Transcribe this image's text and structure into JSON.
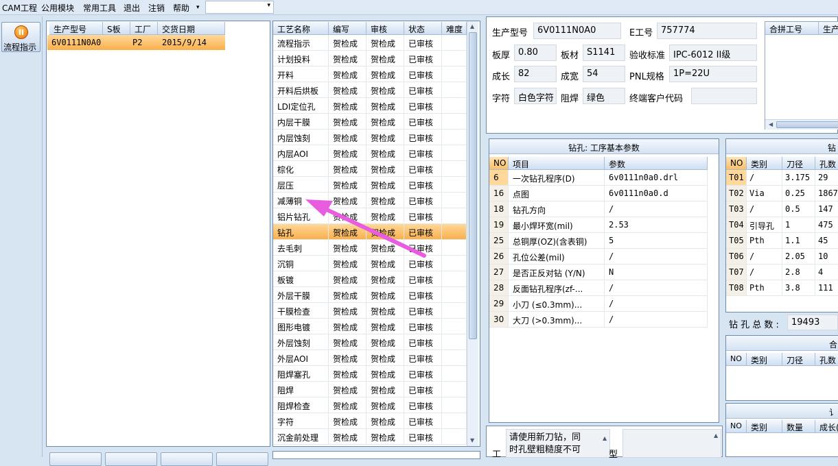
{
  "menu": {
    "items": [
      "CAM工程",
      "公用模块",
      "常用工具",
      "退出",
      "注销",
      "帮助"
    ],
    "help_arrow": "▾",
    "combo_arrow": "▾",
    "combo_value": ""
  },
  "nav": {
    "flow_label": "流程指示"
  },
  "orders": {
    "headers": [
      "生产型号",
      "S板",
      "工厂",
      "交货日期"
    ],
    "rows": [
      [
        "6V0111N0A0",
        "",
        "P2",
        "2015/9/14"
      ]
    ]
  },
  "process": {
    "headers": [
      "工艺名称",
      "编写",
      "审核",
      "状态",
      "难度"
    ],
    "selected_index": 12,
    "rows": [
      [
        "流程指示",
        "贺检成",
        "贺检成",
        "已审核",
        ""
      ],
      [
        "计划投料",
        "贺检成",
        "贺检成",
        "已审核",
        ""
      ],
      [
        "开料",
        "贺检成",
        "贺检成",
        "已审核",
        ""
      ],
      [
        "开料后烘板",
        "贺检成",
        "贺检成",
        "已审核",
        ""
      ],
      [
        "LDI定位孔",
        "贺检成",
        "贺检成",
        "已审核",
        ""
      ],
      [
        "内层干膜",
        "贺检成",
        "贺检成",
        "已审核",
        ""
      ],
      [
        "内层蚀刻",
        "贺检成",
        "贺检成",
        "已审核",
        ""
      ],
      [
        "内层AOI",
        "贺检成",
        "贺检成",
        "已审核",
        ""
      ],
      [
        "棕化",
        "贺检成",
        "贺检成",
        "已审核",
        ""
      ],
      [
        "层压",
        "贺检成",
        "贺检成",
        "已审核",
        ""
      ],
      [
        "减薄铜",
        "贺检成",
        "贺检成",
        "已审核",
        ""
      ],
      [
        "铝片钻孔",
        "贺检成",
        "贺检成",
        "已审核",
        ""
      ],
      [
        "钻孔",
        "贺检成",
        "贺检成",
        "已审核",
        ""
      ],
      [
        "去毛刺",
        "贺检成",
        "贺检成",
        "已审核",
        ""
      ],
      [
        "沉铜",
        "贺检成",
        "贺检成",
        "已审核",
        ""
      ],
      [
        "板镀",
        "贺检成",
        "贺检成",
        "已审核",
        ""
      ],
      [
        "外层干膜",
        "贺检成",
        "贺检成",
        "已审核",
        ""
      ],
      [
        "干膜检查",
        "贺检成",
        "贺检成",
        "已审核",
        ""
      ],
      [
        "图形电镀",
        "贺检成",
        "贺检成",
        "已审核",
        ""
      ],
      [
        "外层蚀刻",
        "贺检成",
        "贺检成",
        "已审核",
        ""
      ],
      [
        "外层AOI",
        "贺检成",
        "贺检成",
        "已审核",
        ""
      ],
      [
        "阻焊塞孔",
        "贺检成",
        "贺检成",
        "已审核",
        ""
      ],
      [
        "阻焊",
        "贺检成",
        "贺检成",
        "已审核",
        ""
      ],
      [
        "阻焊检查",
        "贺检成",
        "贺检成",
        "已审核",
        ""
      ],
      [
        "字符",
        "贺检成",
        "贺检成",
        "已审核",
        ""
      ],
      [
        "沉金前处理",
        "贺检成",
        "贺检成",
        "已审核",
        ""
      ]
    ]
  },
  "info": {
    "prod_model_label": "生产型号",
    "prod_model": "6V0111N0A0",
    "eng_no_label": "E工号",
    "eng_no": "757774",
    "thickness_label": "板厚",
    "thickness": "0.80",
    "material_label": "板材",
    "material": "S1141",
    "standard_label": "验收标准",
    "standard": "IPC-6012 II级",
    "length_label": "成长",
    "length": "82",
    "width_label": "成宽",
    "width": "54",
    "pnl_label": "PNL规格",
    "pnl": "1P=22U",
    "char_label": "字符",
    "char": "白色字符",
    "mask_label": "阻焊",
    "mask": "绿色",
    "customer_label": "终端客户代码",
    "customer": ""
  },
  "merge": {
    "headers": [
      "合拼工号",
      "生产"
    ]
  },
  "drill_params": {
    "title": "钻孔: 工序基本参数",
    "headers": [
      "NO",
      "项目",
      "参数"
    ],
    "rows": [
      [
        "6",
        "一次钻孔程序(D)",
        "6v0111n0a0.drl"
      ],
      [
        "16",
        "点图",
        "6v0111n0a0.d"
      ],
      [
        "18",
        "钻孔方向",
        "/"
      ],
      [
        "19",
        "最小焊环宽(mil)",
        "2.53"
      ],
      [
        "25",
        "总铜厚(OZ)(含表铜)",
        "5"
      ],
      [
        "26",
        "孔位公差(mil)",
        "/"
      ],
      [
        "27",
        "是否正反对钻 (Y/N)",
        "N"
      ],
      [
        "28",
        "反面钻孔程序(zf-...",
        "/"
      ],
      [
        "29",
        "小刀 (≤0.3mm)...",
        "/"
      ],
      [
        "30",
        "大刀 (>0.3mm)...",
        "/"
      ]
    ]
  },
  "tools": {
    "title": "钻",
    "headers": [
      "NO",
      "类别",
      "刀径",
      "孔数"
    ],
    "rows": [
      [
        "T01",
        "/",
        "3.175",
        "29"
      ],
      [
        "T02",
        "Via",
        "0.25",
        "1867"
      ],
      [
        "T03",
        "/",
        "0.5",
        "147"
      ],
      [
        "T04",
        "引导孔",
        "1",
        "475"
      ],
      [
        "T05",
        "Pth",
        "1.1",
        "45"
      ],
      [
        "T06",
        "/",
        "2.05",
        "10"
      ],
      [
        "T07",
        "/",
        "2.8",
        "4"
      ],
      [
        "T08",
        "Pth",
        "3.8",
        "111"
      ]
    ],
    "total_label": "钻 孔 总 数 :",
    "total": "19493"
  },
  "sub1": {
    "title": "合",
    "headers": [
      "NO",
      "类别",
      "刀径",
      "孔数"
    ]
  },
  "sub2": {
    "title": "讠",
    "headers": [
      "NO",
      "类别",
      "数量",
      "成长("
    ]
  },
  "note": {
    "label": "工",
    "text_line1": "请使用新刀钻，同",
    "text_line2": "时孔壁粗糙度不可",
    "type_label": "型"
  },
  "colors": {
    "selected_row": "#f9b04c",
    "arrow": "#e85ce0"
  }
}
